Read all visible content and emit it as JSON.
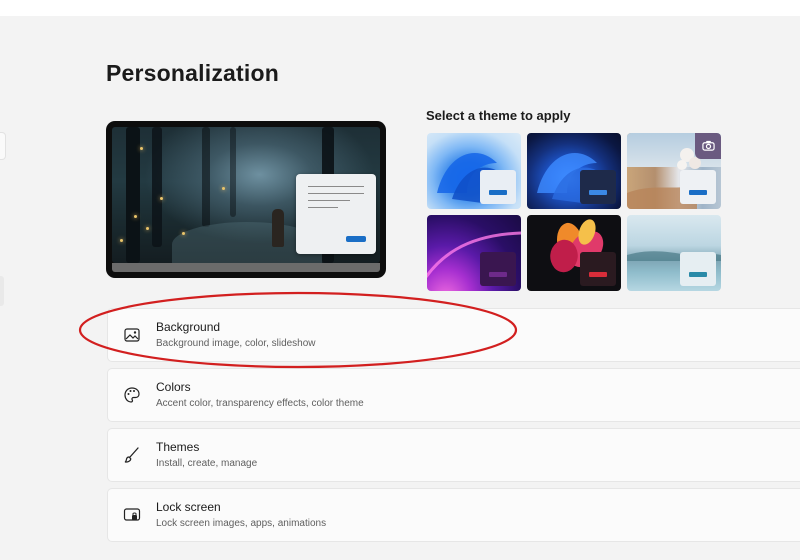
{
  "page": {
    "title": "Personalization"
  },
  "themes": {
    "label": "Select a theme to apply",
    "items": [
      {
        "name": "windows-light-theme",
        "accent": "#1a6ec6"
      },
      {
        "name": "windows-dark-theme",
        "accent": "#3b88e5"
      },
      {
        "name": "captured-motion-theme",
        "accent": "#1a6ec6",
        "icon": "camera-icon"
      },
      {
        "name": "glow-theme",
        "accent": "#6d2a8a"
      },
      {
        "name": "flow-theme",
        "accent": "#d82d3a"
      },
      {
        "name": "sunrise-lake-theme",
        "accent": "#2a8aa8"
      }
    ]
  },
  "settings": [
    {
      "title": "Background",
      "description": "Background image, color, slideshow",
      "icon": "image-icon"
    },
    {
      "title": "Colors",
      "description": "Accent color, transparency effects, color theme",
      "icon": "palette-icon"
    },
    {
      "title": "Themes",
      "description": "Install, create, manage",
      "icon": "brush-icon"
    },
    {
      "title": "Lock screen",
      "description": "Lock screen images, apps, animations",
      "icon": "lock-screen-icon"
    }
  ],
  "annotation": {
    "shape": "ellipse",
    "color": "#d21f1f",
    "target": "Background"
  }
}
